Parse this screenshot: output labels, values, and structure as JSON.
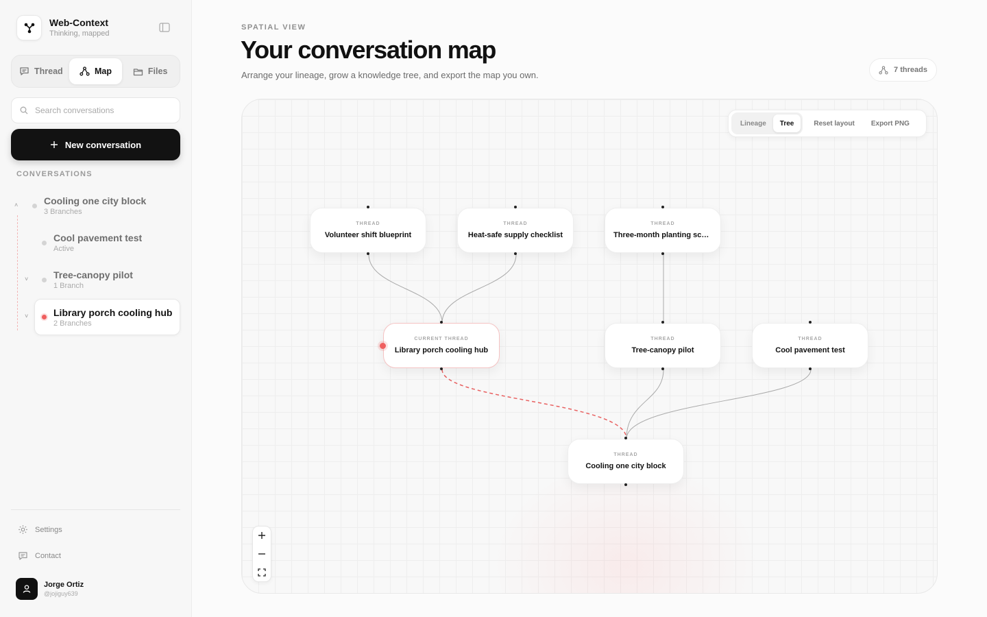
{
  "brand": {
    "name": "Web-Context",
    "tagline": "Thinking, mapped"
  },
  "tabs": [
    {
      "label": "Thread",
      "icon": "chat-icon",
      "active": false
    },
    {
      "label": "Map",
      "icon": "graph-icon",
      "active": true
    },
    {
      "label": "Files",
      "icon": "folder-icon",
      "active": false
    }
  ],
  "search": {
    "placeholder": "Search conversations",
    "value": ""
  },
  "new_conversation": {
    "label": "New conversation"
  },
  "conversations_label": "CONVERSATIONS",
  "conversations": [
    {
      "title": "Cooling one city block",
      "sub": "3 Branches"
    },
    {
      "title": "Cool pavement test",
      "sub": "Active"
    },
    {
      "title": "Tree-canopy pilot",
      "sub": "1 Branch"
    },
    {
      "title": "Library porch cooling hub",
      "sub": "2 Branches"
    }
  ],
  "footer": {
    "settings": "Settings",
    "contact": "Contact"
  },
  "user": {
    "name": "Jorge Ortiz",
    "handle": "@jojiguy639"
  },
  "main": {
    "eyebrow": "SPATIAL VIEW",
    "title": "Your conversation map",
    "description": "Arrange your lineage, grow a knowledge tree, and export the map you own.",
    "thread_count": "7 threads"
  },
  "toolbar": {
    "modes": [
      {
        "label": "Lineage",
        "active": false
      },
      {
        "label": "Tree",
        "active": true
      }
    ],
    "reset": "Reset layout",
    "export": "Export PNG"
  },
  "nodes": [
    {
      "label": "THREAD",
      "title": "Volunteer shift blueprint"
    },
    {
      "label": "THREAD",
      "title": "Heat-safe supply checklist"
    },
    {
      "label": "THREAD",
      "title": "Three-month planting schedule"
    },
    {
      "label": "CURRENT THREAD",
      "title": "Library porch cooling hub"
    },
    {
      "label": "THREAD",
      "title": "Tree-canopy pilot"
    },
    {
      "label": "THREAD",
      "title": "Cool pavement test"
    },
    {
      "label": "THREAD",
      "title": "Cooling one city block"
    }
  ],
  "colors": {
    "accent": "#ef5f5f",
    "primary_button": "#121212"
  }
}
